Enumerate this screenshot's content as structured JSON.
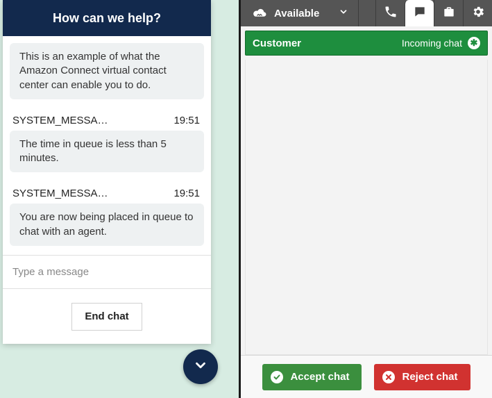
{
  "customer_chat": {
    "header_title": "How can we help?",
    "messages": [
      {
        "sender": "",
        "time": "",
        "text": "This is an example of what the Amazon Connect virtual contact center can enable you to do."
      },
      {
        "sender": "SYSTEM_MESSA…",
        "time": "19:51",
        "text": "The time in queue is less than 5 minutes."
      },
      {
        "sender": "SYSTEM_MESSA…",
        "time": "19:51",
        "text": "You are now being placed in queue to chat with an agent."
      }
    ],
    "input_placeholder": "Type a message",
    "end_chat_label": "End chat",
    "minimize_icon": "chevron-down-icon"
  },
  "agent_panel": {
    "status": {
      "label": "Available",
      "icon": "cloud-status-icon"
    },
    "topbar_icons": [
      "phone-icon",
      "chat-icon",
      "briefcase-icon",
      "gear-icon"
    ],
    "active_topbar_icon": "chat-icon",
    "banner": {
      "left_label": "Customer",
      "right_label": "Incoming chat",
      "badge_icon": "badge-star-icon"
    },
    "actions": {
      "accept_label": "Accept chat",
      "reject_label": "Reject chat"
    }
  }
}
